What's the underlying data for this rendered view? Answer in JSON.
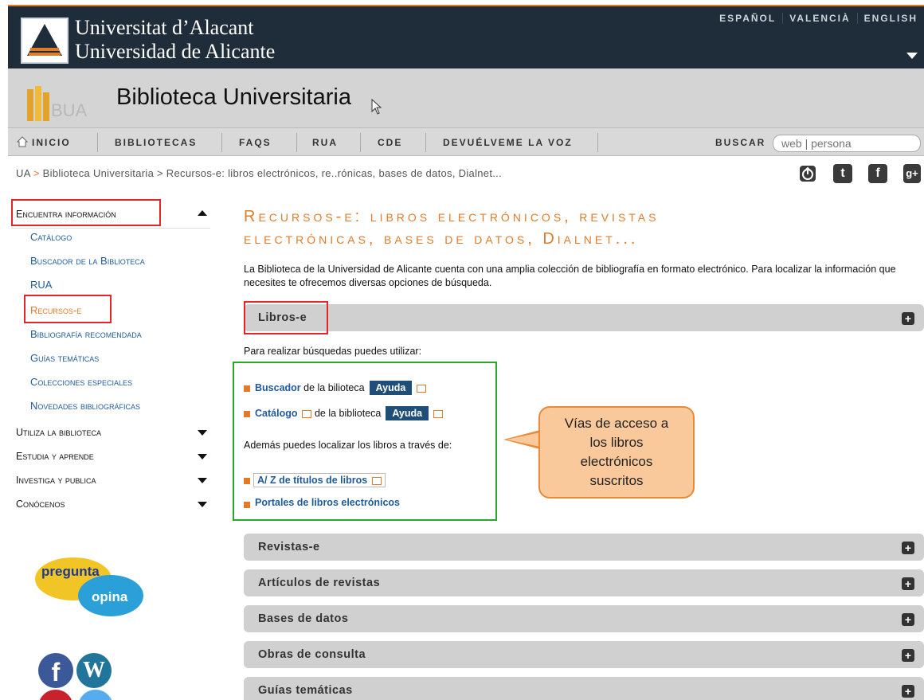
{
  "header": {
    "univ_line1": "Universitat d’Alacant",
    "univ_line2": "Universidad de Alicante",
    "languages": [
      "ESPAÑOL",
      "VALENCIÀ",
      "ENGLISH"
    ]
  },
  "library": {
    "logo_text": "BUA",
    "title": "Biblioteca Universitaria"
  },
  "nav": {
    "items": [
      "INICIO",
      "BIBLIOTECAS",
      "FAQS",
      "RUA",
      "CDE",
      "DEVUÉLVEME LA VOZ"
    ],
    "search_label": "BUSCAR",
    "search_placeholder": "web | persona"
  },
  "breadcrumb": {
    "root": "UA",
    "sep": " > ",
    "trail": "Biblioteca Universitaria > Recursos-e: libros electrónicos, re..rónicas, bases de datos, Dialnet..."
  },
  "sidebar": {
    "sections": [
      {
        "label": "Encuentra información",
        "expanded": true
      },
      {
        "label": "Utiliza la biblioteca",
        "expanded": false
      },
      {
        "label": "Estudia y aprende",
        "expanded": false
      },
      {
        "label": "Investiga y publica",
        "expanded": false
      },
      {
        "label": "Conócenos",
        "expanded": false
      }
    ],
    "items": [
      "Catálogo",
      "Buscador de la Biblioteca",
      "RUA",
      "Recursos-e",
      "Bibliografía recomendada",
      "Guías temáticas",
      "Colecciones especiales",
      "Novedades bibliográficas"
    ],
    "active_item": "Recursos-e",
    "bubble_1": "pregunta",
    "bubble_2": "opina"
  },
  "main": {
    "title_line1": "Recursos-e: libros electrónicos, revistas",
    "title_line2": "electrónicas, bases de datos, Dialnet...",
    "intro": "La Biblioteca de la Universidad de Alicante cuenta con una amplia colección de bibliografía en formato electrónico. Para localizar la información que necesites te ofrecemos diversas opciones de búsqueda.",
    "libros_label": "Libros-e",
    "para_busquedas": "Para realizar búsquedas puedes utilizar:",
    "buscador_link": "Buscador",
    "buscador_rest": " de la bilioteca",
    "catalogo_link": "Catálogo",
    "catalogo_rest": " de la biblioteca",
    "ayuda_label": "Ayuda",
    "ademas": "Además puedes localizar los libros a través de:",
    "az_link": "A/ Z de títulos de libros",
    "portales_link": "Portales de libros electrónicos",
    "accordions": [
      "Revistas-e",
      "Artículos de revistas",
      "Bases de datos",
      "Obras de consulta",
      "Guías temáticas"
    ]
  },
  "callout": {
    "text_l1": "Vías de acceso a",
    "text_l2": "los libros",
    "text_l3": "electrónicos",
    "text_l4": "suscritos"
  },
  "colors": {
    "accent": "#e07b2a",
    "link": "#1f5b9c",
    "header": "#1f2c3a",
    "highlight_red": "#e0262a",
    "highlight_green": "#2aa82a"
  }
}
